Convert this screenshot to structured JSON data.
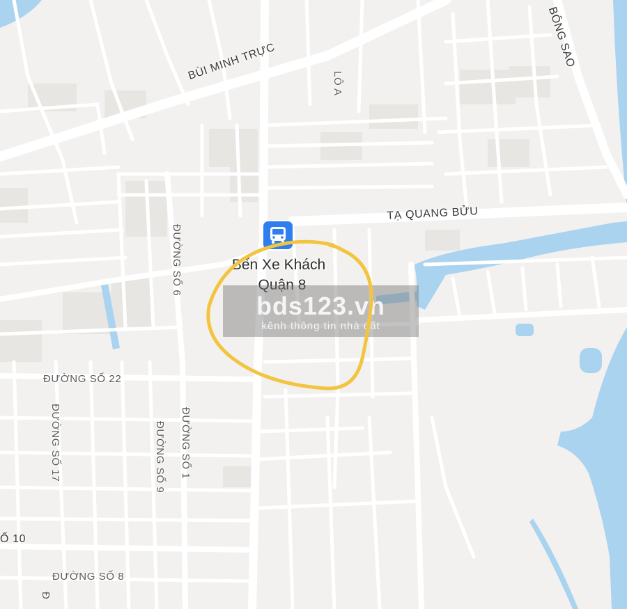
{
  "map": {
    "streets": {
      "bui_minh_truc": "BÙI MINH TRỰC",
      "ta_quang_buu": "TẠ QUANG BỬU",
      "bong_sao": "BÔNG SAO",
      "lo_a": "LÔ A",
      "duong_so_6": "ĐƯỜNG SỐ 6",
      "duong_so_22": "ĐƯỜNG SỐ 22",
      "duong_so_17": "ĐƯỜNG SỐ 17",
      "duong_so_9": "ĐƯỜNG SỐ 9",
      "duong_so_1": "ĐƯỜNG SỐ 1",
      "so_10": "Ố 10",
      "duong_so_8": "ĐƯỜNG SỐ 8",
      "partial_d": "Đ"
    },
    "poi": {
      "name_line1": "Bến Xe Khách",
      "name_line2": "Quận 8",
      "icon": "bus-icon"
    },
    "highlight": {
      "color": "#f2c440",
      "shape": "circle"
    }
  },
  "watermark": {
    "title": "bds123.vn",
    "subtitle": "kênh thông tin nhà đất"
  },
  "colors": {
    "land": "#f2f1ef",
    "road": "#ffffff",
    "water": "#a9d3ef",
    "poi_accent": "#2f7ef0"
  }
}
